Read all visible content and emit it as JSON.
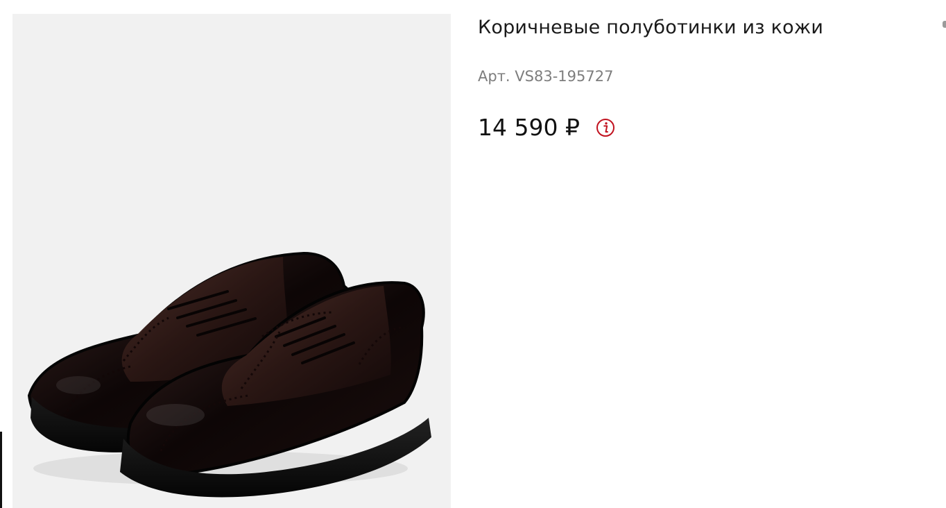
{
  "product": {
    "title": "Коричневые полуботинки из кожи",
    "sku": "Арт. VS83-195727",
    "price": "14 590 ₽",
    "image_alt": "brown-leather-brogue-shoes",
    "info_icon": "info-icon",
    "accent_color": "#c1121f"
  }
}
